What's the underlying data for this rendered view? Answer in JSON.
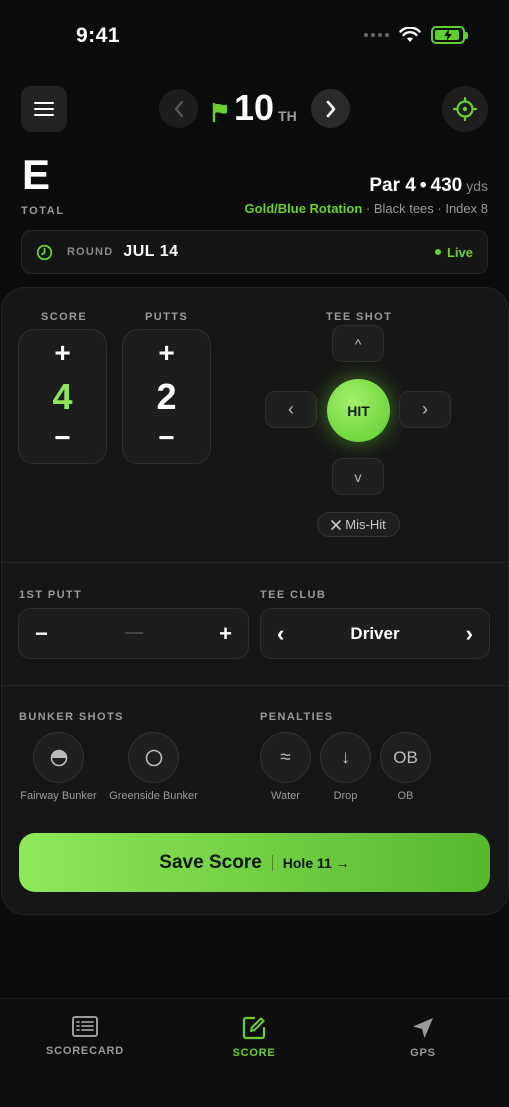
{
  "status": {
    "time": "9:41"
  },
  "nav": {
    "hole_number": "10",
    "hole_suffix": "TH",
    "flag_color": "#6ccf2e"
  },
  "header": {
    "total_score": "E",
    "total_label": "TOTAL",
    "par": "Par 4",
    "separator": "•",
    "yards": "430",
    "yards_unit": "yds",
    "rotation": "Gold/Blue Rotation",
    "tees": " · Black tees · Index 8"
  },
  "round": {
    "label": "ROUND",
    "date": "JUL 14",
    "status": "Live"
  },
  "score": {
    "label": "SCORE",
    "value": "4",
    "plus": "+",
    "minus": "−"
  },
  "putts": {
    "label": "PUTTS",
    "value": "2",
    "plus": "+",
    "minus": "−"
  },
  "tee_shot": {
    "label": "TEE SHOT",
    "up": "^",
    "down": "v",
    "left": "‹",
    "right": "›",
    "center": "HIT",
    "mishit": "Mis-Hit"
  },
  "first_putt": {
    "label": "1ST PUTT",
    "minus": "−",
    "plus": "+"
  },
  "tee_club": {
    "label": "TEE CLUB",
    "value": "Driver",
    "prev": "‹",
    "next": "›"
  },
  "bunker": {
    "label": "BUNKER SHOTS",
    "items": [
      {
        "label": "Fairway Bunker",
        "icon": "half-circle-icon"
      },
      {
        "label": "Greenside Bunker",
        "icon": "circle-icon"
      }
    ]
  },
  "penalties": {
    "label": "PENALTIES",
    "items": [
      {
        "label": "Water",
        "glyph": "≈"
      },
      {
        "label": "Drop",
        "glyph": "↓"
      },
      {
        "label": "OB",
        "glyph": "OB"
      }
    ]
  },
  "save": {
    "label": "Save Score",
    "next": "Hole 11 →"
  },
  "tabs": [
    {
      "label": "SCORECARD",
      "active": false
    },
    {
      "label": "SCORE",
      "active": true
    },
    {
      "label": "GPS",
      "active": false
    }
  ],
  "colors": {
    "accent": "#6ccf2e",
    "background": "#0c0c0c",
    "card": "#161616"
  }
}
